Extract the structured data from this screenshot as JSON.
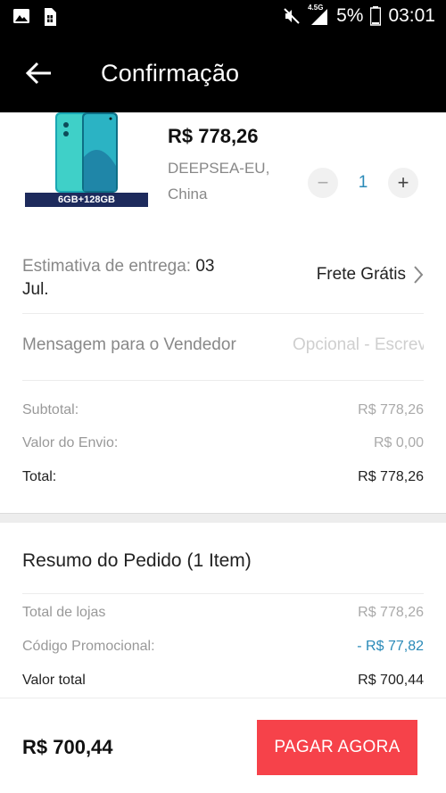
{
  "status_bar": {
    "network": "4.5G",
    "battery": "5%",
    "time": "03:01"
  },
  "header": {
    "title": "Confirmação"
  },
  "product": {
    "image_badge": "6GB+128GB",
    "price": "R$ 778,26",
    "seller": "DEEPSEA-EU, China",
    "quantity": "1",
    "minus_label": "−",
    "plus_label": "+"
  },
  "shipping": {
    "delivery_label": "Estimativa de entrega:",
    "delivery_date": "03 Jul.",
    "method": "Frete Grátis"
  },
  "message": {
    "label": "Mensagem para o Vendedor",
    "placeholder": "Opcional - Escreva aqui"
  },
  "store_summary": {
    "subtotal_label": "Subtotal:",
    "subtotal_value": "R$ 778,26",
    "shipping_label": "Valor do Envio:",
    "shipping_value": "R$ 0,00",
    "total_label": "Total:",
    "total_value": "R$ 778,26"
  },
  "order_summary": {
    "title": "Resumo do Pedido (1 Item)",
    "stores_label": "Total de lojas",
    "stores_value": "R$ 778,26",
    "promo_label": "Código Promocional:",
    "promo_value": "- R$ 77,82",
    "grand_label": "Valor total",
    "grand_value": "R$ 700,44"
  },
  "checkout": {
    "total": "R$ 700,44",
    "button_label": "PAGAR AGORA"
  },
  "colors": {
    "accent": "#f6424a",
    "link_blue": "#2a8ab8"
  }
}
